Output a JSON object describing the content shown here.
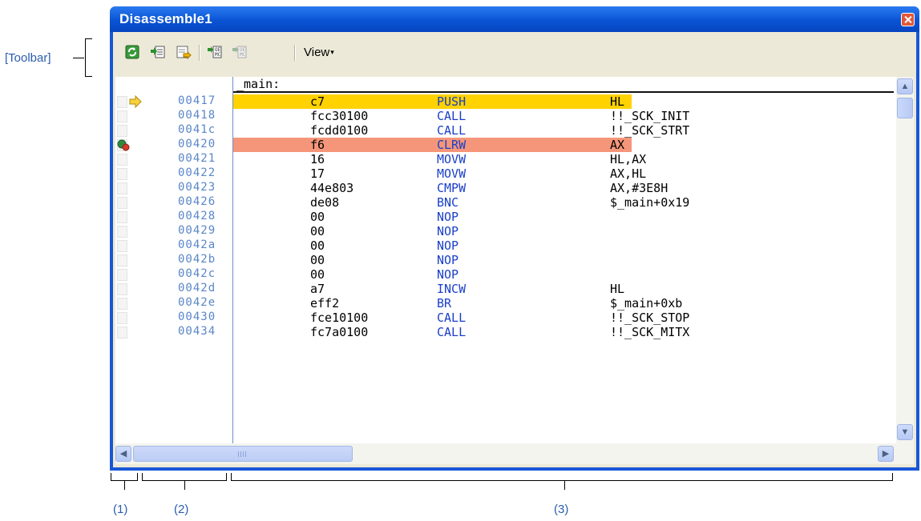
{
  "annotations": {
    "toolbar_label": "[Toolbar]",
    "area1": "(1)",
    "area2": "(2)",
    "area3": "(3)"
  },
  "window": {
    "title": "Disassemble1"
  },
  "toolbar": {
    "buttons": [
      "refresh-icon",
      "go-to-pc-icon",
      "goto-address-icon",
      "step-in-icon",
      "step-over-icon"
    ],
    "view_menu_label": "View",
    "view_menu_arrow": "▾"
  },
  "disassembly": {
    "label": "_main:",
    "rows": [
      {
        "address": "00417",
        "bytes": "c7",
        "mnemonic": "PUSH",
        "operand": "HL"
      },
      {
        "address": "00418",
        "bytes": "fcc30100",
        "mnemonic": "CALL",
        "operand": "!!_SCK_INIT"
      },
      {
        "address": "0041c",
        "bytes": "fcdd0100",
        "mnemonic": "CALL",
        "operand": "!!_SCK_STRT"
      },
      {
        "address": "00420",
        "bytes": "f6",
        "mnemonic": "CLRW",
        "operand": "AX"
      },
      {
        "address": "00421",
        "bytes": "16",
        "mnemonic": "MOVW",
        "operand": "HL,AX"
      },
      {
        "address": "00422",
        "bytes": "17",
        "mnemonic": "MOVW",
        "operand": "AX,HL"
      },
      {
        "address": "00423",
        "bytes": "44e803",
        "mnemonic": "CMPW",
        "operand": "AX,#3E8H"
      },
      {
        "address": "00426",
        "bytes": "de08",
        "mnemonic": "BNC",
        "operand": "$_main+0x19"
      },
      {
        "address": "00428",
        "bytes": "00",
        "mnemonic": "NOP",
        "operand": ""
      },
      {
        "address": "00429",
        "bytes": "00",
        "mnemonic": "NOP",
        "operand": ""
      },
      {
        "address": "0042a",
        "bytes": "00",
        "mnemonic": "NOP",
        "operand": ""
      },
      {
        "address": "0042b",
        "bytes": "00",
        "mnemonic": "NOP",
        "operand": ""
      },
      {
        "address": "0042c",
        "bytes": "00",
        "mnemonic": "NOP",
        "operand": ""
      },
      {
        "address": "0042d",
        "bytes": "a7",
        "mnemonic": "INCW",
        "operand": "HL"
      },
      {
        "address": "0042e",
        "bytes": "eff2",
        "mnemonic": "BR",
        "operand": "$_main+0xb"
      },
      {
        "address": "00430",
        "bytes": "fce10100",
        "mnemonic": "CALL",
        "operand": "!!_SCK_STOP"
      },
      {
        "address": "00434",
        "bytes": "fc7a0100",
        "mnemonic": "CALL",
        "operand": "!!_SCK_MITX"
      }
    ],
    "current_pc_row": 0,
    "breakpoint_row": 3,
    "colors": {
      "pc_highlight": "#ffd200",
      "breakpoint_highlight": "#f5967a",
      "address_text": "#5a86c7",
      "mnemonic_text": "#1a3fc8"
    }
  }
}
